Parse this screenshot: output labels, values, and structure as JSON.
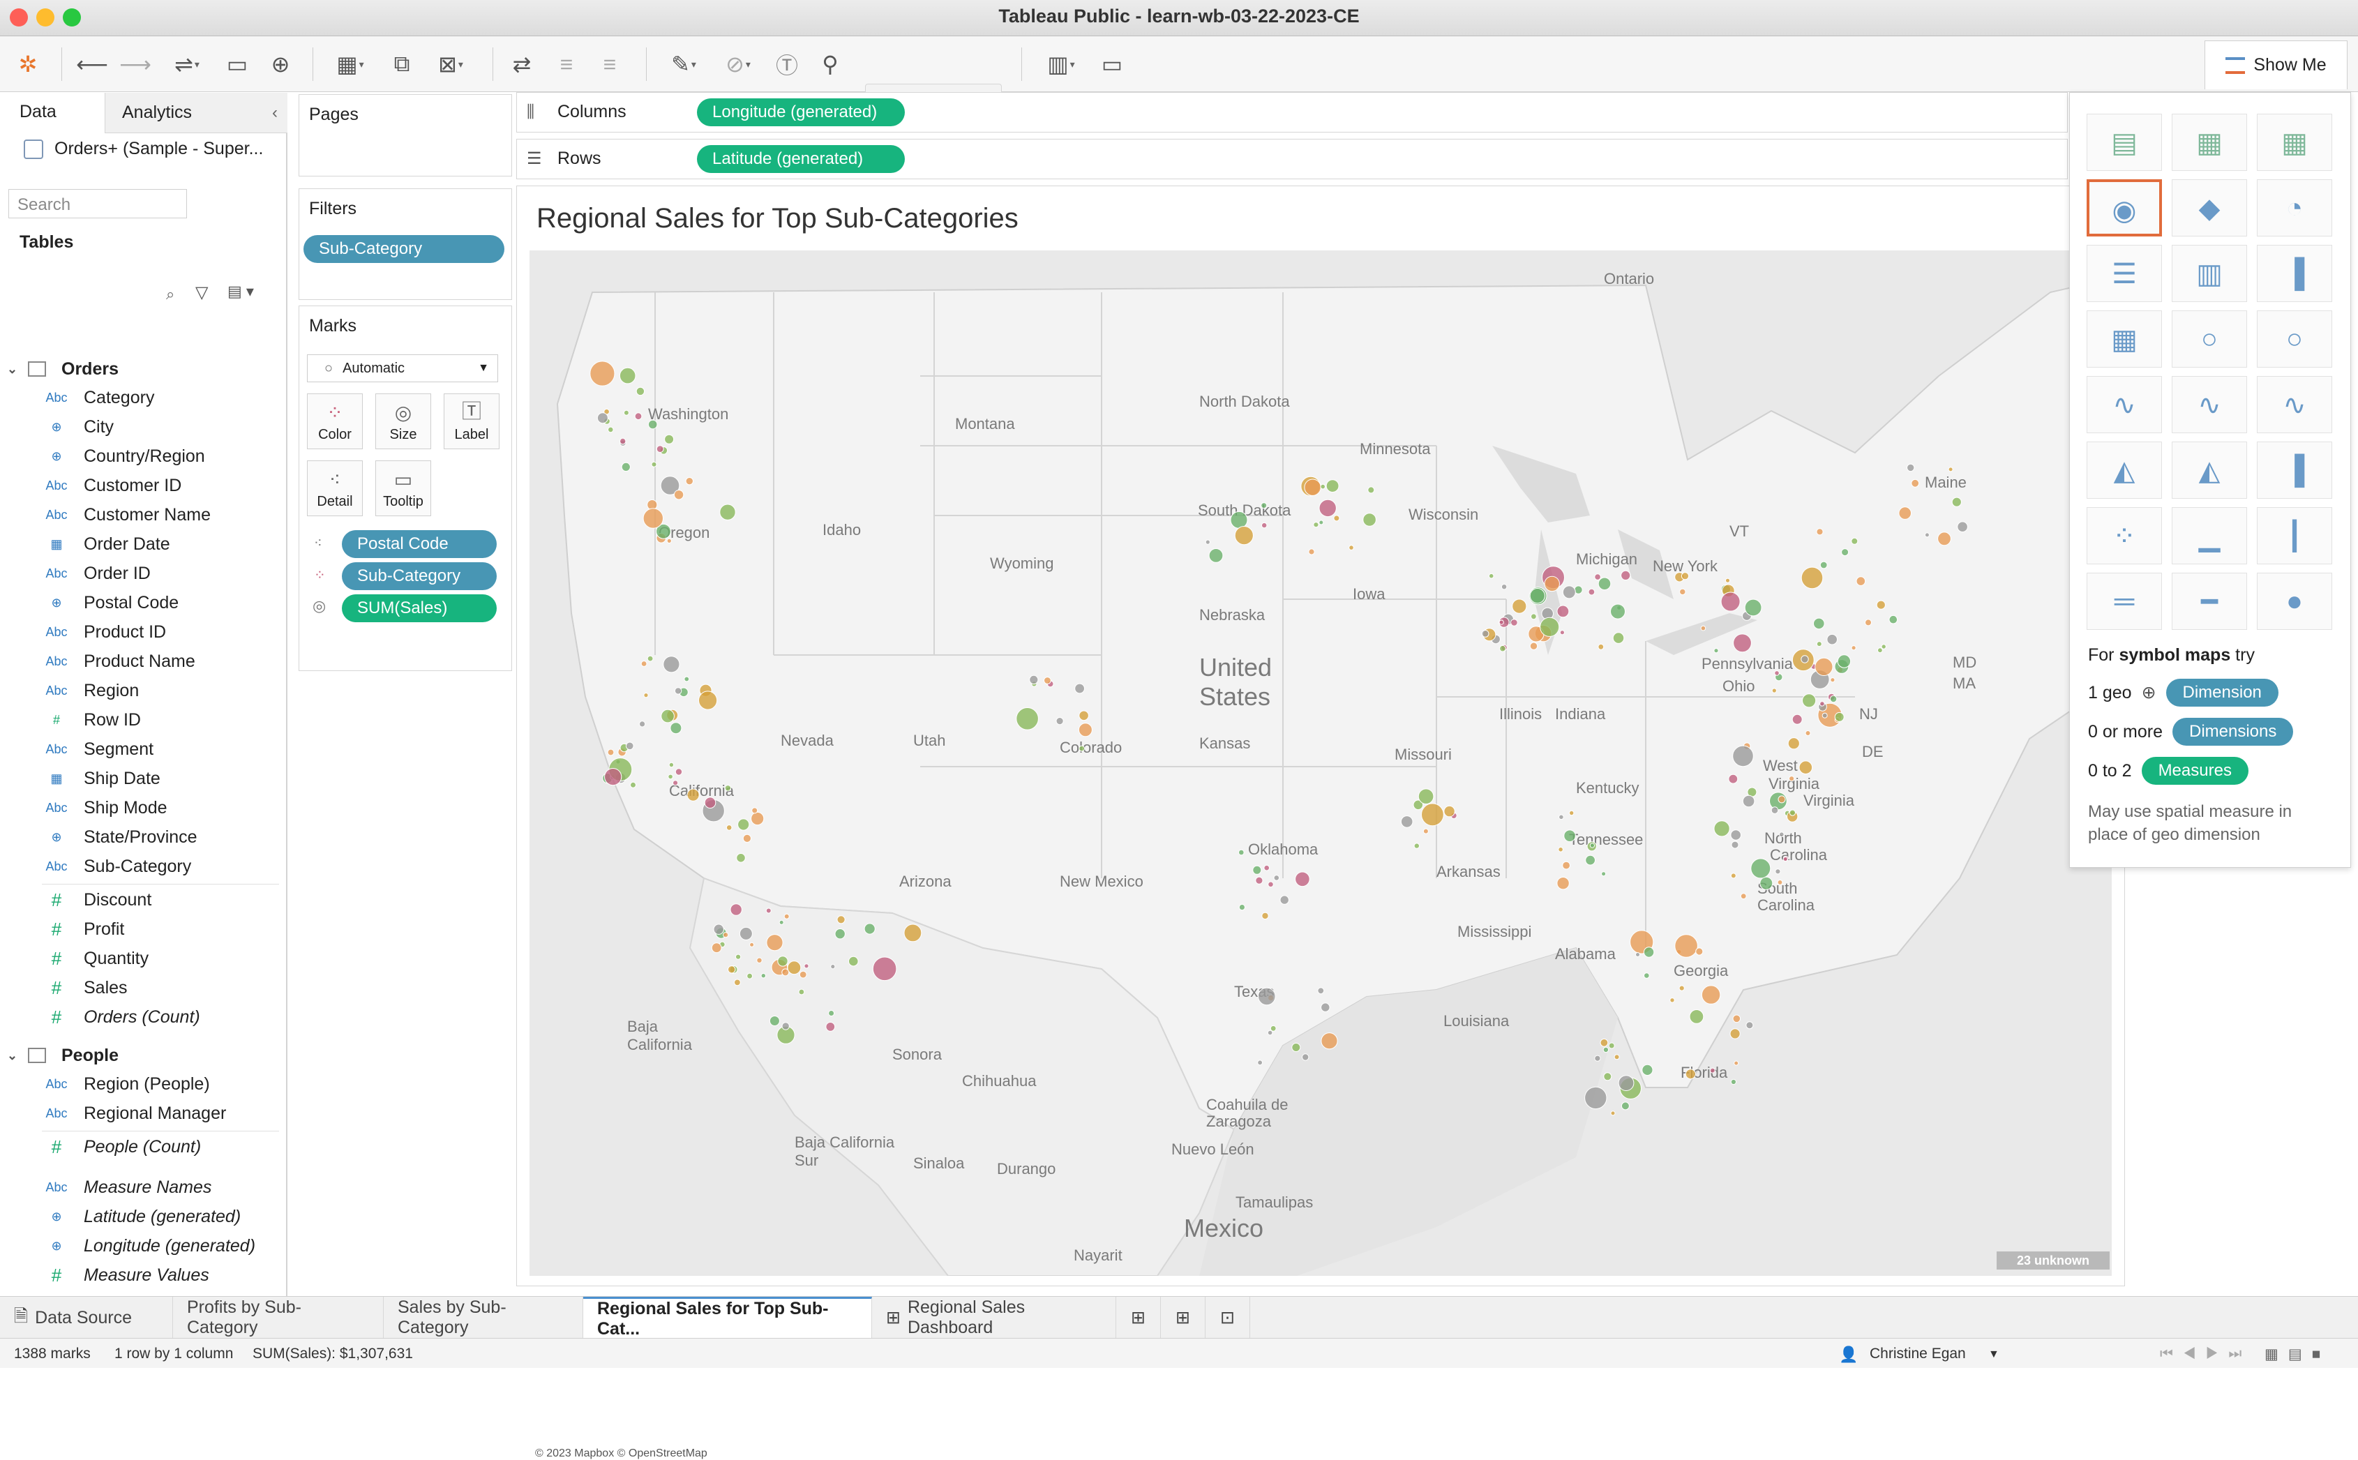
{
  "window": {
    "title": "Tableau Public - learn-wb-03-22-2023-CE"
  },
  "toolbar": {
    "show_me": "Show Me"
  },
  "data_pane": {
    "tabs": {
      "data": "Data",
      "analytics": "Analytics"
    },
    "datasource": "Orders+ (Sample - Super...",
    "search_placeholder": "Search",
    "tables_heading": "Tables",
    "orders": {
      "name": "Orders",
      "fields": [
        {
          "type": "Abc",
          "name": "Category"
        },
        {
          "type": "geo",
          "name": "City"
        },
        {
          "type": "geo",
          "name": "Country/Region"
        },
        {
          "type": "Abc",
          "name": "Customer ID"
        },
        {
          "type": "Abc",
          "name": "Customer Name"
        },
        {
          "type": "date",
          "name": "Order Date"
        },
        {
          "type": "Abc",
          "name": "Order ID"
        },
        {
          "type": "geo",
          "name": "Postal Code"
        },
        {
          "type": "Abc",
          "name": "Product ID"
        },
        {
          "type": "Abc",
          "name": "Product Name"
        },
        {
          "type": "Abc",
          "name": "Region"
        },
        {
          "type": "#",
          "name": "Row ID"
        },
        {
          "type": "Abc",
          "name": "Segment"
        },
        {
          "type": "date",
          "name": "Ship Date"
        },
        {
          "type": "Abc",
          "name": "Ship Mode"
        },
        {
          "type": "geo",
          "name": "State/Province"
        },
        {
          "type": "Abc",
          "name": "Sub-Category"
        }
      ],
      "measures": [
        "Discount",
        "Profit",
        "Quantity",
        "Sales",
        "Orders (Count)"
      ]
    },
    "people": {
      "name": "People",
      "fields": [
        "Region (People)",
        "Regional Manager"
      ],
      "measures": [
        "People (Count)"
      ]
    },
    "extras": [
      {
        "type": "Abc",
        "name": "Measure Names"
      },
      {
        "type": "geo",
        "name": "Latitude (generated)"
      },
      {
        "type": "geo",
        "name": "Longitude (generated)"
      },
      {
        "type": "#",
        "name": "Measure Values"
      }
    ]
  },
  "cards": {
    "pages": "Pages",
    "filters": "Filters",
    "filter_pill": "Sub-Category",
    "marks": "Marks",
    "mark_type": "Automatic",
    "buttons": [
      "Color",
      "Size",
      "Label",
      "Detail",
      "Tooltip"
    ],
    "mark_pills": [
      "Postal Code",
      "Sub-Category",
      "SUM(Sales)"
    ]
  },
  "shelves": {
    "columns_label": "Columns",
    "columns_pill": "Longitude (generated)",
    "rows_label": "Rows",
    "rows_pill": "Latitude (generated)"
  },
  "viz": {
    "title": "Regional Sales for Top Sub-Categories",
    "attribution": "© 2023 Mapbox © OpenStreetMap",
    "unknown_badge": "23 unknown",
    "map_labels": [
      "Ontario",
      "Washington",
      "Montana",
      "North Dakota",
      "Minnesota",
      "Oregon",
      "Idaho",
      "South Dakota",
      "Wisconsin",
      "Wyoming",
      "Michigan",
      "New York",
      "Maine",
      "VT",
      "Iowa",
      "Nebraska",
      "United",
      "States",
      "Pennsylvania",
      "Ohio",
      "Illinois",
      "Indiana",
      "Nevada",
      "Utah",
      "Colorado",
      "Kansas",
      "Missouri",
      "West",
      "Virginia",
      "Virginia",
      "Kentucky",
      "California",
      "MD",
      "DE",
      "NJ",
      "MA",
      "Tennessee",
      "North",
      "Carolina",
      "Oklahoma",
      "Arkansas",
      "Arizona",
      "New Mexico",
      "South",
      "Carolina",
      "Mississippi",
      "Alabama",
      "Georgia",
      "Texas",
      "Louisiana",
      "Baja",
      "California",
      "Sonora",
      "Chihuahua",
      "Coahuila de",
      "Zaragoza",
      "Florida",
      "Baja California",
      "Sur",
      "Sinaloa",
      "Durango",
      "Nuevo León",
      "Tamaulipas",
      "Mexico",
      "Nayarit"
    ]
  },
  "show_me": {
    "for_prefix": "For ",
    "for_bold": "symbol maps",
    "for_suffix": " try",
    "rows": [
      {
        "count": "1 geo",
        "pill": "Dimension",
        "color": "#4896b4"
      },
      {
        "count": "0 or more",
        "pill": "Dimensions",
        "color": "#4896b4"
      },
      {
        "count": "0 to 2",
        "pill": "Measures",
        "color": "#17b47e"
      }
    ],
    "note": "May use spatial measure in place of geo dimension"
  },
  "sheet_tabs": [
    "Data Source",
    "Profits by Sub-Category",
    "Sales by Sub-Category",
    "Regional Sales for Top Sub-Cat...",
    "Regional Sales Dashboard"
  ],
  "status": {
    "marks": "1388 marks",
    "dims": "1 row by 1 column",
    "sum": "SUM(Sales): $1,307,631",
    "user": "Christine Egan"
  },
  "colors": {
    "blue_pill": "#4896b4",
    "green_pill": "#17b47e",
    "selected": "#e16c3c"
  }
}
